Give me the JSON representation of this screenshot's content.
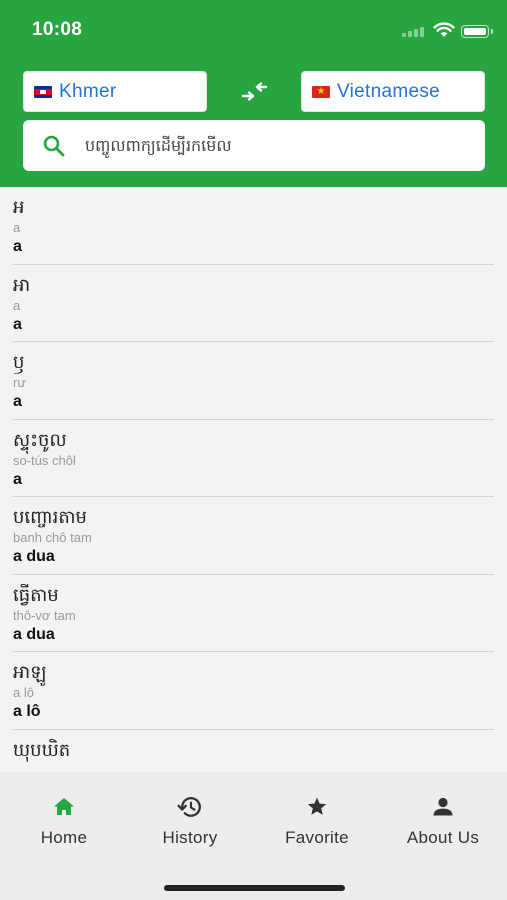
{
  "status": {
    "time": "10:08"
  },
  "translator": {
    "source_language": "Khmer",
    "target_language": "Vietnamese",
    "source_flag": "flag-cambodia",
    "target_flag": "flag-vietnam",
    "swap_icon": "swap-arrows-icon"
  },
  "search": {
    "placeholder": "បញ្ចូលពាក្យដើម្បីរកមើល",
    "value": ""
  },
  "words": [
    {
      "khmer": "អ",
      "romanization": "a",
      "translation": "a"
    },
    {
      "khmer": "អា",
      "romanization": "a",
      "translation": "a"
    },
    {
      "khmer": "ឫ",
      "romanization": "rư",
      "translation": "a"
    },
    {
      "khmer": "ស្ទុះចូល",
      "romanization": "so-tús chôl",
      "translation": "a"
    },
    {
      "khmer": "បញ្ចោរតាម",
      "romanization": "banh chô tam",
      "translation": "a dua"
    },
    {
      "khmer": "ធ្វើតាម",
      "romanization": "thô-vơ tam",
      "translation": "a dua"
    },
    {
      "khmer": "អាឡូ",
      "romanization": "a lô",
      "translation": "a lô"
    },
    {
      "khmer": "ឃុបឃិត",
      "romanization": "",
      "translation": ""
    }
  ],
  "tabs": [
    {
      "label": "Home",
      "icon": "home-icon",
      "active": true
    },
    {
      "label": "History",
      "icon": "history-icon",
      "active": false
    },
    {
      "label": "Favorite",
      "icon": "star-icon",
      "active": false
    },
    {
      "label": "About Us",
      "icon": "person-icon",
      "active": false
    }
  ],
  "colors": {
    "brand_green": "#26a540",
    "link_blue": "#2573d6",
    "active_tab": "#26a540",
    "inactive_tab": "#333333"
  }
}
